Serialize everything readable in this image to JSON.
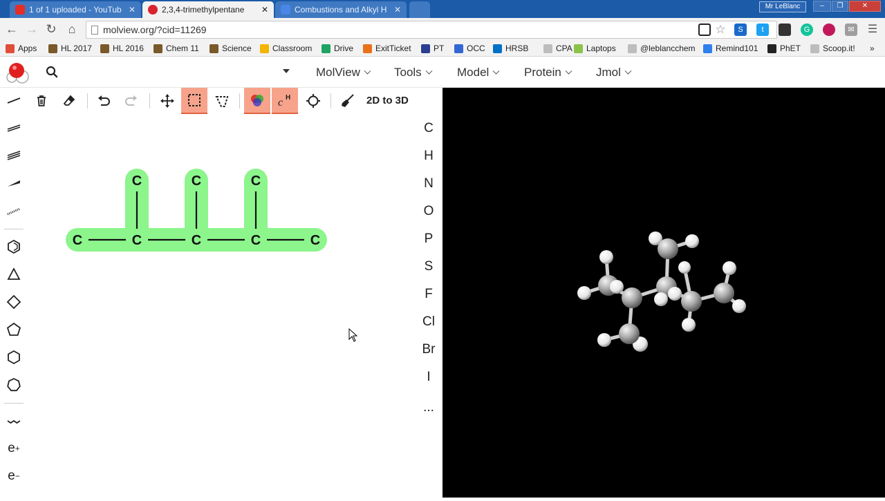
{
  "browser": {
    "tabs": [
      {
        "title": "1 of 1 uploaded - YouTub",
        "favicon_color": "#e52d27",
        "active": false
      },
      {
        "title": "2,3,4-trimethylpentane",
        "favicon_color": "#d9232e",
        "active": true
      },
      {
        "title": "Combustions and Alkyl H",
        "favicon_color": "#4a86e8",
        "active": false
      }
    ],
    "user": "Mr LeBlanc",
    "url": "molview.org/?cid=11269",
    "bookmarks": [
      {
        "label": "Apps",
        "icon_color": "#e04e39"
      },
      {
        "label": "HL 2017",
        "icon_color": "#7a5a2a"
      },
      {
        "label": "HL 2016",
        "icon_color": "#7a5a2a"
      },
      {
        "label": "Chem 11",
        "icon_color": "#7a5a2a"
      },
      {
        "label": "Science",
        "icon_color": "#7a5a2a"
      },
      {
        "label": "Classroom",
        "icon_color": "#f4b400"
      },
      {
        "label": "Drive",
        "icon_color": "#1fa463"
      },
      {
        "label": "ExitTicket",
        "icon_color": "#e8711a"
      },
      {
        "label": "PT",
        "icon_color": "#2c3e8f"
      },
      {
        "label": "OCC",
        "icon_color": "#3367d6"
      },
      {
        "label": "HRSB",
        "icon_color": "#0072c6"
      },
      {
        "label": "CPA",
        "icon_color": "#bdbdbd"
      },
      {
        "label": "Laptops",
        "icon_color": "#8bc34a"
      },
      {
        "label": "@leblancchem",
        "icon_color": "#bdbdbd"
      },
      {
        "label": "Remind101",
        "icon_color": "#2f80ed"
      },
      {
        "label": "PhET",
        "icon_color": "#222222"
      },
      {
        "label": "Scoop.it!",
        "icon_color": "#bdbdbd"
      }
    ],
    "bookmarks_more": "»"
  },
  "app": {
    "search_placeholder": "",
    "menus": [
      "MolView",
      "Tools",
      "Model",
      "Protein",
      "Jmol"
    ],
    "convert_label": "2D to 3D",
    "elements": [
      "C",
      "H",
      "N",
      "O",
      "P",
      "S",
      "F",
      "Cl",
      "Br",
      "I",
      "..."
    ],
    "charge_plus": "e",
    "charge_minus": "e",
    "charge_plus_sup": "+",
    "charge_minus_sup": "−",
    "highlight_color": "#8cf58c"
  },
  "molecule": {
    "atom_label": "C",
    "atoms": [
      "C",
      "C",
      "C",
      "C",
      "C",
      "C",
      "C",
      "C"
    ]
  }
}
